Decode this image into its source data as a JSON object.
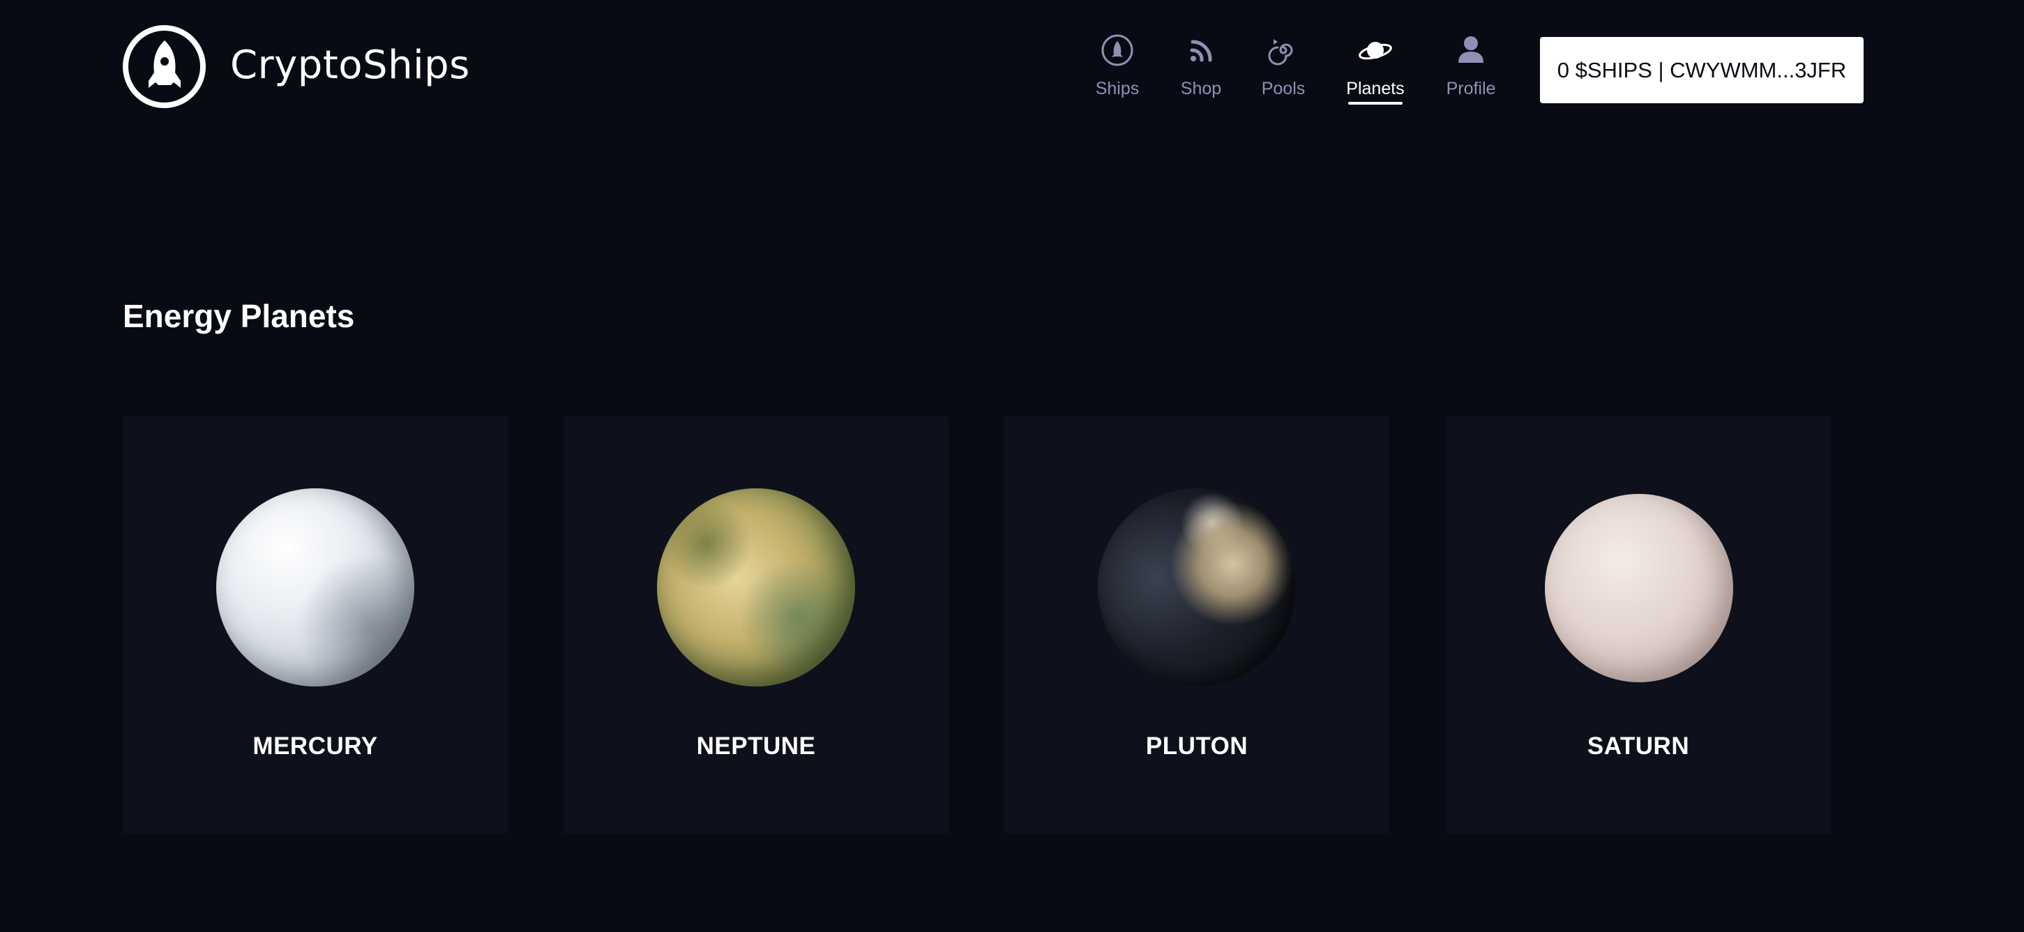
{
  "header": {
    "brand": "CryptoShips",
    "logo_icon": "rocket-icon",
    "nav": [
      {
        "label": "Ships",
        "icon": "ship-circle-icon",
        "active": false
      },
      {
        "label": "Shop",
        "icon": "rss-signal-icon",
        "active": false
      },
      {
        "label": "Pools",
        "icon": "spiral-icon",
        "active": false
      },
      {
        "label": "Planets",
        "icon": "planet-ring-icon",
        "active": true
      },
      {
        "label": "Profile",
        "icon": "user-icon",
        "active": false
      }
    ],
    "wallet": "0 $SHIPS | CWYWMM...3JFR"
  },
  "main": {
    "section_title": "Energy Planets",
    "planets": [
      {
        "name": "MERCURY"
      },
      {
        "name": "NEPTUNE"
      },
      {
        "name": "PLUTON"
      },
      {
        "name": "SATURN"
      }
    ]
  },
  "colors": {
    "background": "#090b14",
    "card": "#0e111b",
    "nav_inactive": "#8f91b4",
    "nav_active": "#ffffff",
    "wallet_bg": "#ffffff"
  }
}
